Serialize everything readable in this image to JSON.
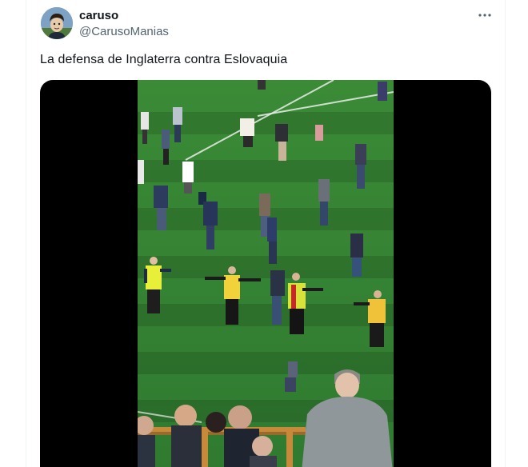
{
  "tweet": {
    "display_name": "caruso",
    "handle": "@CarusoManias",
    "text": "La defensa de Inglaterra contra Eslovaquia",
    "more_icon": "more-horizontal-icon",
    "avatar_icon": "avatar-illustration"
  },
  "media": {
    "type": "video",
    "description_icon": "video-frame-pitch-invasion"
  },
  "colors": {
    "text_primary": "#0f1419",
    "text_secondary": "#536471",
    "pitch": "#3f8a3a",
    "steward_vest": "#e9f23a"
  }
}
